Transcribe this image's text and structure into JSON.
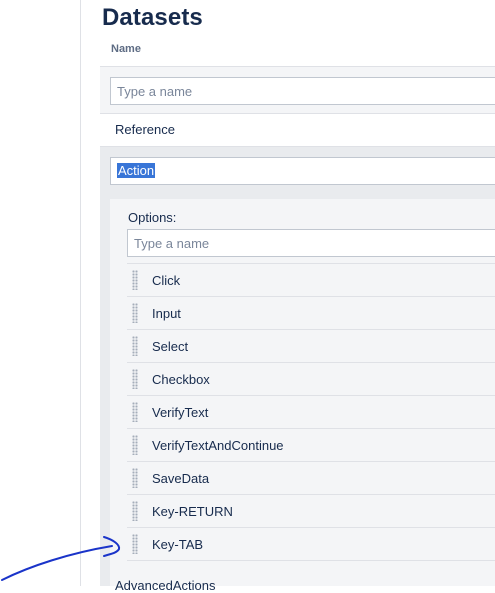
{
  "page": {
    "title": "Datasets"
  },
  "name_field": {
    "label": "Name",
    "placeholder": "Type a name",
    "value": ""
  },
  "reference": {
    "label": "Reference"
  },
  "action_field": {
    "value": "Action"
  },
  "options": {
    "label": "Options:",
    "placeholder": "Type a name",
    "items": [
      {
        "label": "Click"
      },
      {
        "label": "Input"
      },
      {
        "label": "Select"
      },
      {
        "label": "Checkbox"
      },
      {
        "label": "VerifyText"
      },
      {
        "label": "VerifyTextAndContinue"
      },
      {
        "label": "SaveData"
      },
      {
        "label": "Key-RETURN"
      },
      {
        "label": "Key-TAB"
      }
    ]
  },
  "advanced": {
    "label": "AdvancedActions"
  },
  "annotation": {
    "color": "#1a34c9"
  }
}
